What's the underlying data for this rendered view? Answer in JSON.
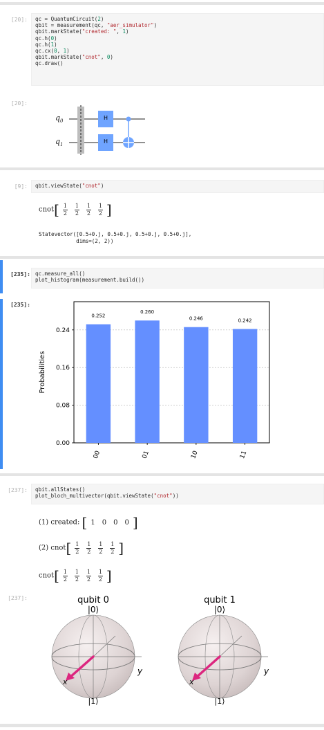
{
  "cells": {
    "c1": {
      "in_prompt": "[20]:",
      "out_prompt": "[20]:",
      "code": [
        "qc = QuantumCircuit(2)",
        "qbit = measurement(qc, \"aer_simulator\")",
        "qbit.markState(\"created: \", 1)",
        "qc.h(0)",
        "qc.h(1)",
        "qc.cx(0, 1)",
        "qbit.markState(\"cnot\", 0)",
        "qc.draw()"
      ],
      "circuit": {
        "q0_label": "q",
        "q0_sub": "0",
        "q1_label": "q",
        "q1_sub": "1",
        "gate_h": "H"
      }
    },
    "c2": {
      "in_prompt": "[9]:",
      "code": [
        "qbit.viewState(\"cnot\")"
      ],
      "state_label": "cnot",
      "frac_num": "1",
      "frac_den": "2",
      "statevector_line1": "Statevector([0.5+0.j, 0.5+0.j, 0.5+0.j, 0.5+0.j],",
      "statevector_line2": "            dims=(2, 2))"
    },
    "c3": {
      "in_prompt": "[235]:",
      "out_prompt": "[235]:",
      "code": [
        "qc.measure_all()",
        "plot_histogram(measurement.build())"
      ]
    },
    "c4": {
      "in_prompt": "[237]:",
      "out_prompt": "[237]:",
      "code": [
        "qbit.allStates()",
        "plot_bloch_multivector(qbit.viewState(\"cnot\"))"
      ],
      "state1_label": "(1) created:",
      "state1_values": [
        "1",
        "0",
        "0",
        "0"
      ],
      "state2_label": "(2) cnot",
      "state3_label": "cnot",
      "bloch": [
        {
          "title": "qubit 0",
          "top": "|0⟩",
          "bottom": "|1⟩",
          "x": "x",
          "y": "y"
        },
        {
          "title": "qubit 1",
          "top": "|0⟩",
          "bottom": "|1⟩",
          "x": "x",
          "y": "y"
        }
      ]
    }
  },
  "chart_data": {
    "type": "bar",
    "categories": [
      "00",
      "01",
      "10",
      "11"
    ],
    "values": [
      0.252,
      0.26,
      0.246,
      0.242
    ],
    "value_labels": [
      "0.252",
      "0.260",
      "0.246",
      "0.242"
    ],
    "ylabel": "Probabilities",
    "yticks": [
      "0.00",
      "0.08",
      "0.16",
      "0.24"
    ],
    "ylim": [
      0,
      0.3
    ],
    "grid": true,
    "bar_color": "#648fff"
  },
  "colors": {
    "accent": "#3f8df2",
    "bar": "#648fff",
    "gate": "#6fa4ff",
    "bloch_vector": "#dc267f"
  }
}
